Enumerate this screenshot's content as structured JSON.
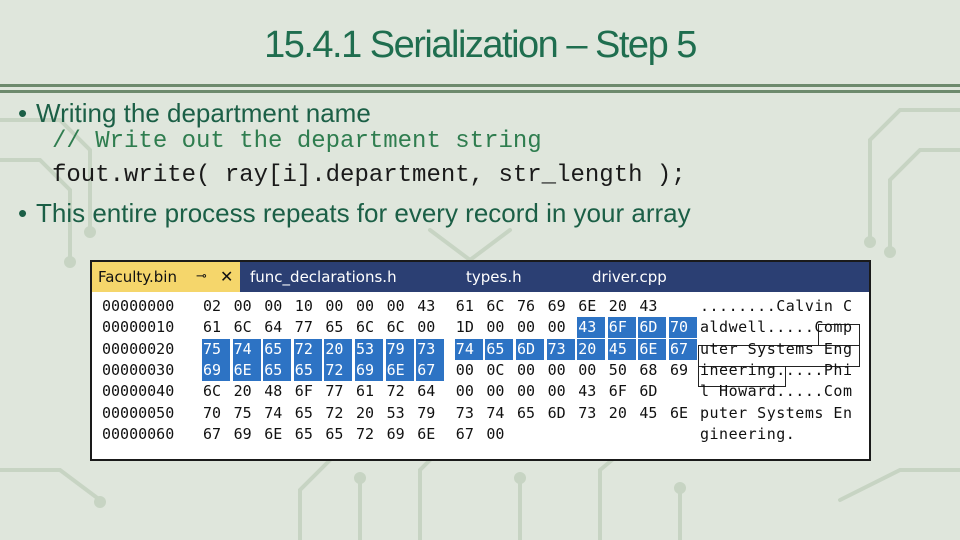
{
  "slide": {
    "title": "15.4.1 Serialization – Step 5",
    "bullets": [
      "Writing the department name",
      "This entire process repeats for every record in your array"
    ],
    "code": [
      "// Write out the department string",
      "fout.write( ray[i].department, str_length );"
    ],
    "colors": {
      "title": "#1f6e4f",
      "bullet": "#1b5f46",
      "comment": "#2f7d4f",
      "selection": "#2d73c4",
      "tabbar": "#2b3f73",
      "active_tab": "#f5d66b"
    }
  },
  "hex_editor": {
    "tabs": [
      {
        "label": "Faculty.bin",
        "pin_icon": "pin-icon",
        "close_icon": "close-icon"
      },
      {
        "label": "func_declarations.h"
      },
      {
        "label": "types.h"
      },
      {
        "label": "driver.cpp"
      }
    ],
    "rows": [
      {
        "address": "00000000",
        "bytes": [
          "02",
          "00",
          "00",
          "10",
          "00",
          "00",
          "00",
          "43",
          "61",
          "6C",
          "76",
          "69",
          "6E",
          "20",
          "43"
        ],
        "ascii": "........Calvin C"
      },
      {
        "address": "00000010",
        "bytes": [
          "61",
          "6C",
          "64",
          "77",
          "65",
          "6C",
          "6C",
          "00",
          "1D",
          "00",
          "00",
          "00",
          "43",
          "6F",
          "6D",
          "70"
        ],
        "ascii": "aldwell.....Comp"
      },
      {
        "address": "00000020",
        "bytes": [
          "75",
          "74",
          "65",
          "72",
          "20",
          "53",
          "79",
          "73",
          "74",
          "65",
          "6D",
          "73",
          "20",
          "45",
          "6E",
          "67"
        ],
        "ascii": "uter Systems Eng"
      },
      {
        "address": "00000030",
        "bytes": [
          "69",
          "6E",
          "65",
          "65",
          "72",
          "69",
          "6E",
          "67",
          "00",
          "0C",
          "00",
          "00",
          "00",
          "50",
          "68",
          "69"
        ],
        "ascii": "ineering.....Phi"
      },
      {
        "address": "00000040",
        "bytes": [
          "6C",
          "20",
          "48",
          "6F",
          "77",
          "61",
          "72",
          "64",
          "00",
          "00",
          "00",
          "00",
          "43",
          "6F",
          "6D"
        ],
        "ascii": "l Howard.....Com"
      },
      {
        "address": "00000050",
        "bytes": [
          "70",
          "75",
          "74",
          "65",
          "72",
          "20",
          "53",
          "79",
          "73",
          "74",
          "65",
          "6D",
          "73",
          "20",
          "45",
          "6E"
        ],
        "ascii": "puter Systems En"
      },
      {
        "address": "00000060",
        "bytes": [
          "67",
          "69",
          "6E",
          "65",
          "65",
          "72",
          "69",
          "6E",
          "67",
          "00"
        ],
        "ascii": "gineering."
      }
    ]
  }
}
